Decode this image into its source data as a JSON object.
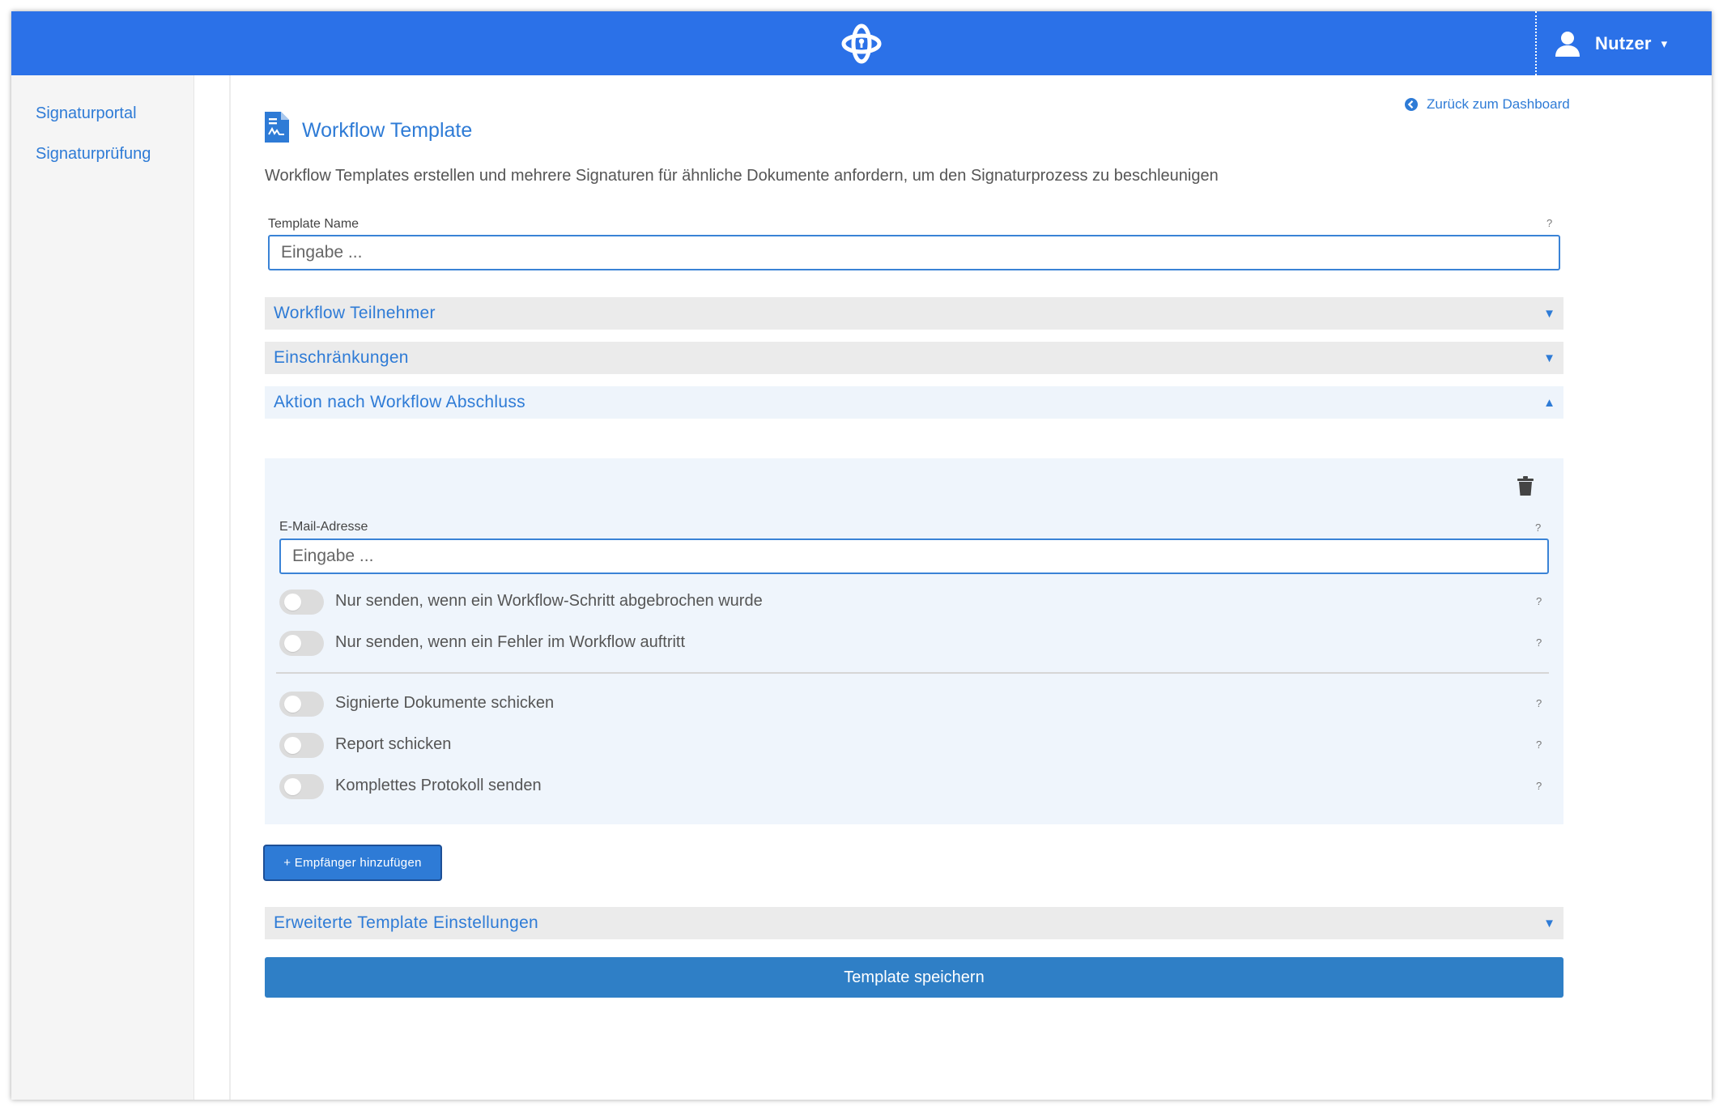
{
  "header": {
    "user_name": "Nutzer",
    "user_caret": "▾",
    "brand_color": "#2b71e8"
  },
  "sidebar": {
    "items": [
      {
        "label": "Signaturportal"
      },
      {
        "label": "Signaturprüfung"
      }
    ]
  },
  "main": {
    "back_link": "Zurück zum Dashboard",
    "title": "Workflow Template",
    "description": "Workflow Templates erstellen und mehrere Signaturen für ähnliche Dokumente anfordern, um den Signaturprozess zu beschleunigen",
    "template_name": {
      "label": "Template Name",
      "placeholder": "Eingabe ...",
      "help": "?"
    },
    "sections": [
      {
        "label": "Workflow Teilnehmer",
        "caret": "▼",
        "expanded": false
      },
      {
        "label": "Einschränkungen",
        "caret": "▼",
        "expanded": false
      },
      {
        "label": "Aktion nach Workflow Abschluss",
        "caret": "▲",
        "expanded": true
      }
    ],
    "recipient": {
      "email_label": "E-Mail-Adresse",
      "email_placeholder": "Eingabe ...",
      "help": "?",
      "toggles": [
        {
          "label": "Nur senden, wenn ein Workflow-Schritt abgebrochen wurde",
          "on": false,
          "help": "?"
        },
        {
          "label": "Nur senden, wenn ein Fehler im Workflow auftritt",
          "on": false,
          "help": "?"
        },
        {
          "label": "Signierte Dokumente schicken",
          "on": false,
          "help": "?"
        },
        {
          "label": "Report schicken",
          "on": false,
          "help": "?"
        },
        {
          "label": "Komplettes Protokoll senden",
          "on": false,
          "help": "?"
        }
      ]
    },
    "add_recipient_button": "+ Empfänger hinzufügen",
    "advanced_section": {
      "label": "Erweiterte Template Einstellungen",
      "caret": "▼"
    },
    "save_button": "Template speichern",
    "accent_color": "#2e7bd6"
  }
}
